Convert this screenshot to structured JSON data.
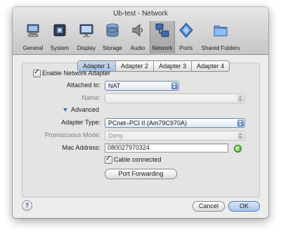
{
  "window": {
    "title": "Ub-test - Network"
  },
  "toolbar": {
    "items": [
      {
        "label": "General",
        "icon": "general-icon"
      },
      {
        "label": "System",
        "icon": "system-icon"
      },
      {
        "label": "Display",
        "icon": "display-icon"
      },
      {
        "label": "Storage",
        "icon": "storage-icon"
      },
      {
        "label": "Audio",
        "icon": "audio-icon"
      },
      {
        "label": "Network",
        "icon": "network-icon",
        "active": true
      },
      {
        "label": "Ports",
        "icon": "ports-icon"
      },
      {
        "label": "Shared Folders",
        "icon": "shared-folders-icon"
      }
    ]
  },
  "tabs": [
    {
      "label": "Adapter 1",
      "selected": true
    },
    {
      "label": "Adapter 2"
    },
    {
      "label": "Adapter 3"
    },
    {
      "label": "Adapter 4"
    }
  ],
  "form": {
    "enable_label": "Enable Network Adapter",
    "enable_checked": true,
    "attached_to_label": "Attached to:",
    "attached_to_value": "NAT",
    "name_label": "Name:",
    "name_value": "",
    "advanced_label": "Advanced",
    "adapter_type_label": "Adapter Type:",
    "adapter_type_value": "PCnet–PCI II (Am79C970A)",
    "promiscuous_label": "Promiscuous Mode:",
    "promiscuous_value": "Deny",
    "mac_label": "Mac Address:",
    "mac_value": "080027970324",
    "cable_label": "Cable connected",
    "cable_checked": true,
    "port_forwarding_label": "Port Forwarding"
  },
  "footer": {
    "help_label": "?",
    "cancel_label": "Cancel",
    "ok_label": "OK"
  },
  "colors": {
    "selection_blue": "#a9c2e4",
    "window_bg": "#ececec",
    "help_purple": "#6a2ea0"
  }
}
